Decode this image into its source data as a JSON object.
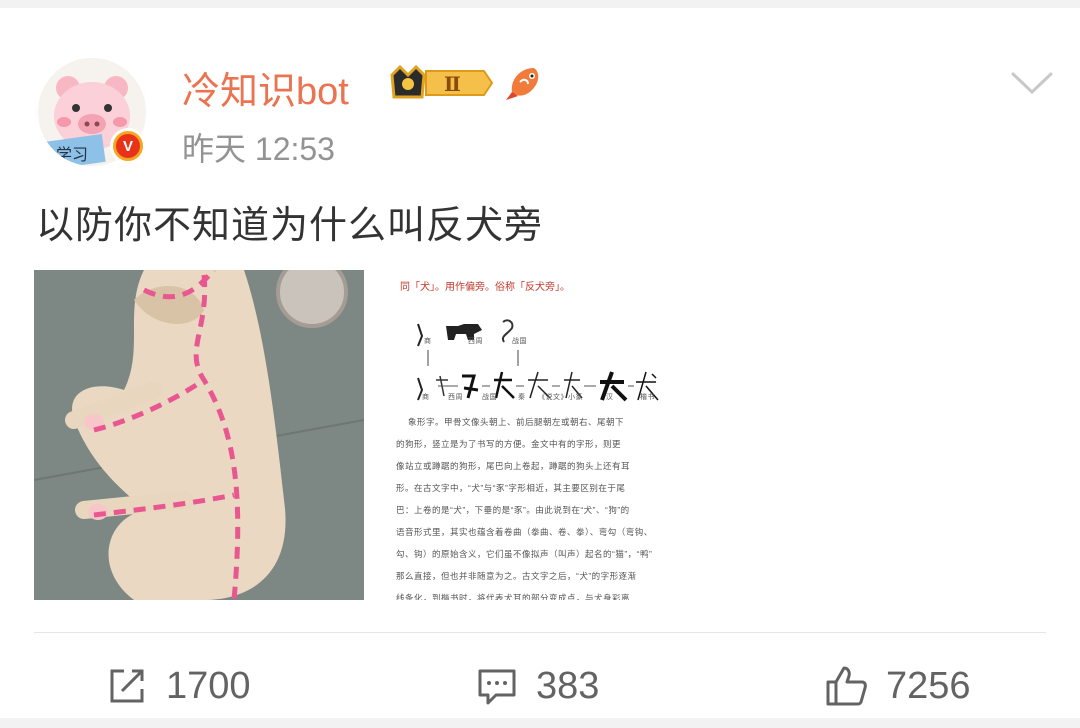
{
  "post": {
    "username": "冷知识bot",
    "level_badge": "Ⅱ",
    "verified_mark": "V",
    "time": "昨天 12:53",
    "text": "以防你不知道为什么叫反犬旁",
    "avatar_label": "学习"
  },
  "book_excerpt": {
    "header": "同「犬」。用作偏旁。俗称「反犬旁」。",
    "lines": [
      "象形字。甲骨文像头朝上、前后腿朝左或朝右、尾朝下",
      "的狗形，竖立是为了书写的方便。金文中有的字形，则更",
      "像站立或蹲踞的狗形，尾巴向上卷起，蹲踞的狗头上还有耳",
      "形。在古文字中，“犬”与“豕”字形相近，其主要区别在于尾",
      "巴：上卷的是“犬”，下垂的是“豕”。由此说到在“犬”、“狗”的",
      "语音形式里，其实也蕴含着卷曲（拳曲、卷、拳）、弯勾（弯钩、",
      "勾、钩）的原始含义，它们虽不像拟声（叫声）起名的“猫”，“鸭”",
      "那么直接，但也并非随意为之。古文字之后，“犬”的字形逐渐",
      "线条化，到楷书时，将代表犬耳的部分变成点，与犬身彩离"
    ],
    "era_labels": [
      "商",
      "西周",
      "战国",
      "商",
      "西周",
      "战国",
      "秦",
      "《说文》小篆",
      "汉",
      "楷书"
    ]
  },
  "actions": {
    "repost_count": "1700",
    "comment_count": "383",
    "like_count": "7256"
  },
  "colors": {
    "username": "#eb7350",
    "time": "#939393",
    "text": "#333333",
    "action": "#636363"
  }
}
